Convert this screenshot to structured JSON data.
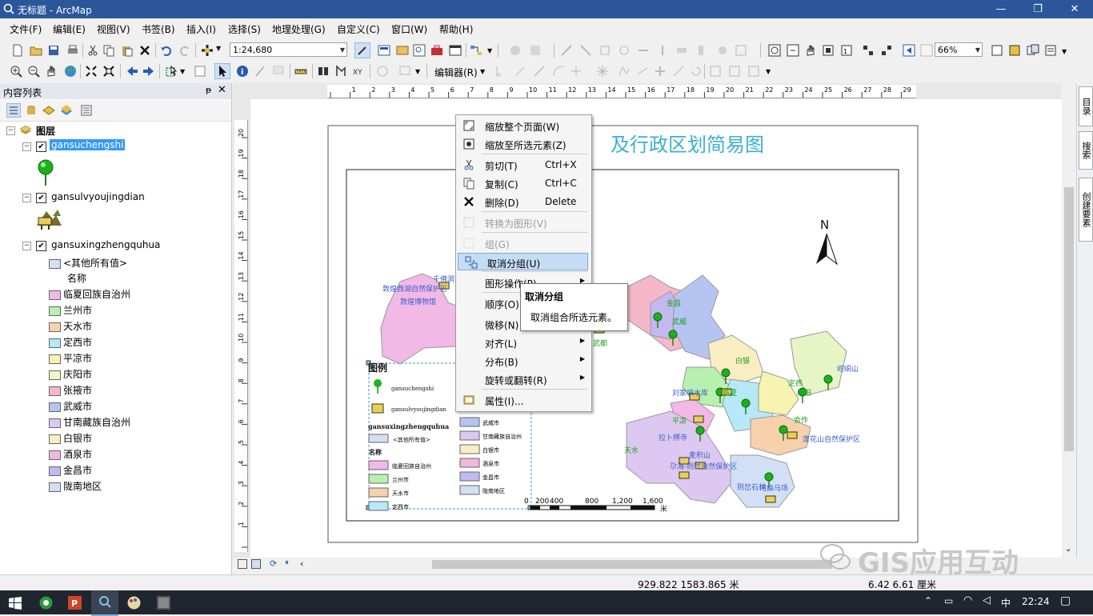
{
  "window": {
    "title": "无标题 - ArcMap",
    "min": "—",
    "restore": "❐",
    "close": "✕"
  },
  "menu": [
    "文件(F)",
    "编辑(E)",
    "视图(V)",
    "书签(B)",
    "插入(I)",
    "选择(S)",
    "地理处理(G)",
    "自定义(C)",
    "窗口(W)",
    "帮助(H)"
  ],
  "toolbar": {
    "scale": "1:24,680",
    "zoom": "66%",
    "editor": "编辑器(R)"
  },
  "toc": {
    "title": "内容列表",
    "root": "图层",
    "layers": [
      {
        "name": "gansuchengshi",
        "selected": true
      },
      {
        "name": "gansulvyoujingdian",
        "selected": false
      },
      {
        "name": "gansuxingzhengquhua",
        "selected": false
      }
    ],
    "other_values": "<其他所有值>",
    "field": "名称",
    "categories": [
      {
        "label": "临夏回族自治州",
        "color": "#f2b8e6"
      },
      {
        "label": "兰州市",
        "color": "#b8f0b0"
      },
      {
        "label": "天水市",
        "color": "#f7d0ac"
      },
      {
        "label": "定西市",
        "color": "#b6e8f5"
      },
      {
        "label": "平凉市",
        "color": "#f7f3b0"
      },
      {
        "label": "庆阳市",
        "color": "#f1f4c6"
      },
      {
        "label": "张掖市",
        "color": "#f4b8c9"
      },
      {
        "label": "武威市",
        "color": "#b6c4f2"
      },
      {
        "label": "甘南藏族自治州",
        "color": "#dcc8f0"
      },
      {
        "label": "白银市",
        "color": "#f8eec2"
      },
      {
        "label": "酒泉市",
        "color": "#f0b8dc"
      },
      {
        "label": "金昌市",
        "color": "#c4b8f0"
      },
      {
        "label": "陇南地区",
        "color": "#d2e0f5"
      }
    ]
  },
  "map": {
    "title": "及行政区划简易图",
    "north": "N",
    "legend_title": "图例",
    "legend_layer1": "gansuchengshi",
    "legend_layer2": "gansulvyoujingdian",
    "legend_layer3": "gansuxingzhengquhua",
    "legend_other": "<其他所有值>",
    "legend_field": "名称",
    "legend_col1": [
      "临夏回族自治州",
      "兰州市",
      "天水市",
      "定西市"
    ],
    "legend_col2": [
      "武威市",
      "甘南藏族自治州",
      "白银市",
      "酒泉市",
      "金昌市",
      "陇南地区"
    ],
    "scalebar": [
      "0",
      "200",
      "400",
      "800",
      "1,200",
      "1,600"
    ],
    "scale_unit": "米",
    "labels": [
      {
        "t": "敦煌西湖自然保护区",
        "c": "#3a5fc8"
      },
      {
        "t": "敦煌博物馆",
        "c": "#3a5fc8"
      },
      {
        "t": "千佛洞",
        "c": "#3a5fc8"
      },
      {
        "t": "金昌",
        "c": "#1aa01a"
      },
      {
        "t": "武威",
        "c": "#1aa01a"
      },
      {
        "t": "白银",
        "c": "#1aa01a"
      },
      {
        "t": "刘家峡水库",
        "c": "#3a5fc8"
      },
      {
        "t": "临夏",
        "c": "#1aa01a"
      },
      {
        "t": "定西",
        "c": "#1aa01a"
      },
      {
        "t": "崆峒山",
        "c": "#3a5fc8"
      },
      {
        "t": "庆阳",
        "c": "#1aa01a"
      },
      {
        "t": "平凉",
        "c": "#1aa01a"
      },
      {
        "t": "拉卜楞寺",
        "c": "#3a5fc8"
      },
      {
        "t": "合作",
        "c": "#1aa01a"
      },
      {
        "t": "莲花山自然保护区",
        "c": "#3a5fc8"
      },
      {
        "t": "天水",
        "c": "#1aa01a"
      },
      {
        "t": "麦积山",
        "c": "#3a5fc8"
      },
      {
        "t": "尕海-则岔自然保护区",
        "c": "#3a5fc8"
      },
      {
        "t": "则岔石林",
        "c": "#3a5fc8"
      },
      {
        "t": "河曲马场",
        "c": "#3a5fc8"
      },
      {
        "t": "武都",
        "c": "#1aa01a"
      },
      {
        "t": "白水江自然保护区",
        "c": "#3a5fc8"
      },
      {
        "t": "护区",
        "c": "#3a5fc8"
      }
    ]
  },
  "context_menu": [
    {
      "label": "缩放整个页面(W)",
      "shortcut": "",
      "disabled": false,
      "icon": "zoom-page-icon"
    },
    {
      "label": "缩放至所选元素(Z)",
      "shortcut": "",
      "disabled": false,
      "icon": "zoom-selected-icon"
    },
    {
      "label": "剪切(T)",
      "shortcut": "Ctrl+X",
      "disabled": false,
      "icon": "scissors-icon"
    },
    {
      "label": "复制(C)",
      "shortcut": "Ctrl+C",
      "disabled": false,
      "icon": "copy-icon"
    },
    {
      "label": "删除(D)",
      "shortcut": "Delete",
      "disabled": false,
      "icon": "delete-icon"
    },
    {
      "label": "转换为图形(V)",
      "shortcut": "",
      "disabled": true,
      "icon": "convert-graphic-icon"
    },
    {
      "label": "组(G)",
      "shortcut": "",
      "disabled": true,
      "icon": "group-icon"
    },
    {
      "label": "取消分组(U)",
      "shortcut": "",
      "disabled": false,
      "icon": "ungroup-icon",
      "highlight": true
    },
    {
      "label": "图形操作(P)",
      "shortcut": "",
      "disabled": false,
      "icon": "",
      "submenu": true
    },
    {
      "label": "顺序(O)",
      "shortcut": "",
      "disabled": false,
      "icon": ""
    },
    {
      "label": "微移(N)",
      "shortcut": "",
      "disabled": false,
      "icon": ""
    },
    {
      "label": "对齐(L)",
      "shortcut": "",
      "disabled": false,
      "icon": "",
      "submenu": true
    },
    {
      "label": "分布(B)",
      "shortcut": "",
      "disabled": false,
      "icon": "",
      "submenu": true
    },
    {
      "label": "旋转或翻转(R)",
      "shortcut": "",
      "disabled": false,
      "icon": "",
      "submenu": true
    },
    {
      "label": "属性(I)...",
      "shortcut": "",
      "disabled": false,
      "icon": "properties-icon"
    }
  ],
  "tooltip": {
    "title": "取消分组",
    "desc": "取消组合所选元素。"
  },
  "right_dock": [
    "目录",
    "搜索",
    "创建要素"
  ],
  "status": {
    "coords": "929.822  1583.865 米",
    "page": "6.42  6.61 厘米"
  },
  "watermark": "GIS应用互动",
  "taskbar": {
    "time": "22:24",
    "ime": "中"
  }
}
